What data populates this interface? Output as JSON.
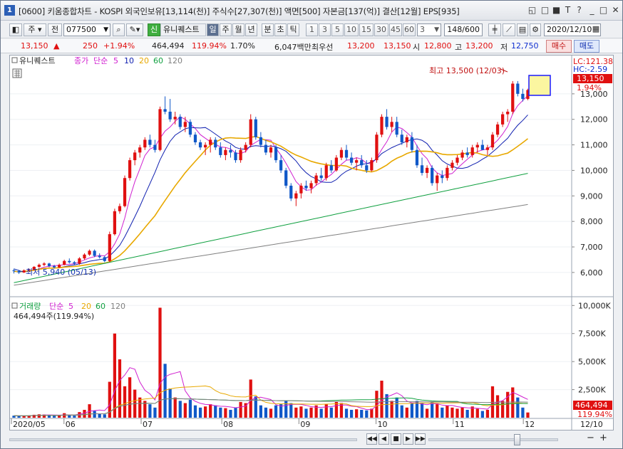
{
  "window": {
    "number": "1",
    "title": "[0600] 키움종합차트 - KOSPI 외국인보유[13,114(천)] 주식수[27,307(천)] 액면[500] 자본금[137(억)] 결산[12월] EPS[935]",
    "controls": [
      "◱",
      "□",
      "■",
      "T",
      "?",
      "_",
      "□",
      "✕"
    ]
  },
  "toolbar": {
    "period_main": "주",
    "mode": "전",
    "code_value": "077500",
    "new_badge": "신",
    "stock_name": "유니퀘스트",
    "periods": [
      "일",
      "주",
      "월",
      "년",
      "분",
      "초",
      "틱"
    ],
    "selected_period": "일",
    "intervals": [
      "1",
      "3",
      "5",
      "10",
      "15",
      "30",
      "45",
      "60"
    ],
    "interval_value": "3",
    "bar_count": "148/600",
    "date": "2020/12/10"
  },
  "quote": {
    "price": "13,150",
    "change_arrow": "▲",
    "change": "250",
    "change_pct": "+1.94%",
    "volume": "464,494",
    "volume_pct": "119.94%",
    "turnover_pct": "1.70%",
    "amount": "6,047백만",
    "best_label": "최우선",
    "ask": "13,200",
    "bid": "13,150",
    "open_label": "시",
    "open": "12,800",
    "high_label": "고",
    "high": "13,200",
    "low_label": "저",
    "low": "12,750",
    "buy_label": "매수",
    "sell_label": "매도"
  },
  "chart_data": [
    {
      "type": "candlestick",
      "title": "유니퀘스트",
      "legend": {
        "price": "종가",
        "ma": "단순",
        "periods": [
          "5",
          "10",
          "20",
          "60",
          "120"
        ],
        "colors": [
          "#d020d0",
          "#1020b0",
          "#e8a800",
          "#10a040",
          "#808080"
        ]
      },
      "y_ticks": [
        "13,000",
        "12,000",
        "11,000",
        "10,000",
        "9,000",
        "8,000",
        "7,000",
        "6,000"
      ],
      "ylim": [
        5300,
        14000
      ],
      "lc_label": "LC:121.38",
      "hc_label": "HC:-2.59",
      "last_price_label": "13,150",
      "last_change_label": "1.94%",
      "annot_high": "최고 13,500 (12/03)",
      "annot_low": "최저 5,940 (05/13)",
      "x_labels": [
        "2020/05",
        "06",
        "07",
        "08",
        "09",
        "10",
        "11",
        "12",
        "12/10"
      ],
      "candles": [
        [
          6080,
          6150,
          5960,
          6050
        ],
        [
          6050,
          6100,
          5940,
          6000
        ],
        [
          6000,
          6120,
          5980,
          6080
        ],
        [
          6080,
          6150,
          6020,
          6100
        ],
        [
          6100,
          6250,
          6080,
          6220
        ],
        [
          6220,
          6350,
          6180,
          6300
        ],
        [
          6300,
          6400,
          6250,
          6350
        ],
        [
          6350,
          6380,
          6200,
          6250
        ],
        [
          6250,
          6300,
          6150,
          6200
        ],
        [
          6200,
          6350,
          6180,
          6300
        ],
        [
          6300,
          6500,
          6280,
          6450
        ],
        [
          6450,
          6550,
          6350,
          6400
        ],
        [
          6400,
          6450,
          6300,
          6350
        ],
        [
          6350,
          6600,
          6300,
          6550
        ],
        [
          6550,
          6750,
          6500,
          6700
        ],
        [
          6700,
          6900,
          6650,
          6850
        ],
        [
          6850,
          6900,
          6600,
          6650
        ],
        [
          6650,
          6750,
          6550,
          6600
        ],
        [
          6600,
          6650,
          6400,
          6450
        ],
        [
          6450,
          7600,
          6400,
          7500
        ],
        [
          7500,
          8500,
          7450,
          8400
        ],
        [
          8400,
          8700,
          8300,
          8600
        ],
        [
          8600,
          9800,
          8550,
          9700
        ],
        [
          9700,
          10500,
          9600,
          10400
        ],
        [
          10400,
          10800,
          10200,
          10700
        ],
        [
          10700,
          11000,
          10500,
          10900
        ],
        [
          10900,
          11300,
          10800,
          11200
        ],
        [
          11200,
          11400,
          10900,
          11000
        ],
        [
          11000,
          11200,
          10700,
          10800
        ],
        [
          10800,
          12500,
          10750,
          12400
        ],
        [
          12400,
          12900,
          12200,
          12300
        ],
        [
          12300,
          12800,
          11900,
          12000
        ],
        [
          12000,
          12300,
          11800,
          12100
        ],
        [
          12100,
          12200,
          11600,
          11700
        ],
        [
          11700,
          12100,
          11500,
          11900
        ],
        [
          11900,
          12000,
          11300,
          11400
        ],
        [
          11400,
          11500,
          11000,
          11100
        ],
        [
          11100,
          11200,
          10800,
          10900
        ],
        [
          10900,
          11100,
          10600,
          11000
        ],
        [
          11000,
          11300,
          10700,
          11200
        ],
        [
          11200,
          11300,
          10800,
          10900
        ],
        [
          10900,
          11100,
          10500,
          10600
        ],
        [
          10600,
          10900,
          10400,
          10800
        ],
        [
          10800,
          11000,
          10500,
          10700
        ],
        [
          10700,
          10800,
          10300,
          10400
        ],
        [
          10400,
          10900,
          10300,
          10800
        ],
        [
          10800,
          11100,
          10700,
          11000
        ],
        [
          11000,
          12200,
          10900,
          12000
        ],
        [
          12000,
          12100,
          11200,
          11300
        ],
        [
          11300,
          11500,
          10900,
          11000
        ],
        [
          11000,
          11200,
          10600,
          10700
        ],
        [
          10700,
          11000,
          10500,
          10900
        ],
        [
          10900,
          11000,
          10300,
          10400
        ],
        [
          10400,
          10600,
          9900,
          10000
        ],
        [
          10000,
          10100,
          9300,
          9400
        ],
        [
          9400,
          9500,
          8800,
          8900
        ],
        [
          8900,
          9200,
          8600,
          9100
        ],
        [
          9100,
          9500,
          8900,
          9400
        ],
        [
          9400,
          9600,
          9200,
          9300
        ],
        [
          9300,
          9600,
          9100,
          9500
        ],
        [
          9500,
          9900,
          9400,
          9800
        ],
        [
          9800,
          10100,
          9600,
          9700
        ],
        [
          9700,
          10300,
          9600,
          10200
        ],
        [
          10200,
          10400,
          9900,
          10000
        ],
        [
          10000,
          10600,
          9950,
          10500
        ],
        [
          10500,
          10900,
          10400,
          10800
        ],
        [
          10800,
          11000,
          10400,
          10500
        ],
        [
          10500,
          10700,
          10200,
          10300
        ],
        [
          10300,
          10500,
          10000,
          10400
        ],
        [
          10400,
          10600,
          10100,
          10200
        ],
        [
          10200,
          10400,
          9900,
          10000
        ],
        [
          10000,
          10500,
          9950,
          10400
        ],
        [
          10400,
          11500,
          10300,
          11400
        ],
        [
          11400,
          12200,
          11300,
          12100
        ],
        [
          12100,
          12400,
          11600,
          11700
        ],
        [
          11700,
          12100,
          11500,
          11900
        ],
        [
          11900,
          12100,
          11300,
          11400
        ],
        [
          11400,
          11600,
          11000,
          11100
        ],
        [
          11100,
          11400,
          10900,
          11300
        ],
        [
          11300,
          11500,
          10700,
          10800
        ],
        [
          10800,
          11000,
          10100,
          10200
        ],
        [
          10200,
          10500,
          9800,
          9900
        ],
        [
          9900,
          10200,
          9700,
          10100
        ],
        [
          10100,
          10200,
          9400,
          9500
        ],
        [
          9500,
          9900,
          9200,
          9800
        ],
        [
          9800,
          10000,
          9500,
          9700
        ],
        [
          9700,
          10200,
          9600,
          10100
        ],
        [
          10100,
          10400,
          10000,
          10300
        ],
        [
          10300,
          10600,
          10200,
          10500
        ],
        [
          10500,
          10800,
          10400,
          10700
        ],
        [
          10700,
          10900,
          10500,
          10600
        ],
        [
          10600,
          11000,
          10500,
          10900
        ],
        [
          10900,
          11100,
          10700,
          11000
        ],
        [
          11000,
          11200,
          10800,
          10800
        ],
        [
          10800,
          11000,
          10600,
          10900
        ],
        [
          10900,
          11500,
          10800,
          11400
        ],
        [
          11400,
          11900,
          11300,
          11800
        ],
        [
          11800,
          12300,
          11700,
          12200
        ],
        [
          12200,
          12400,
          11900,
          12300
        ],
        [
          12300,
          13500,
          12200,
          13400
        ],
        [
          13400,
          13500,
          12900,
          13000
        ],
        [
          13000,
          13200,
          12700,
          12800
        ],
        [
          12800,
          13200,
          12750,
          13150
        ]
      ],
      "ma_series": [
        "MA5",
        "MA10",
        "MA20",
        "MA60",
        "MA120"
      ]
    },
    {
      "type": "bar",
      "title": "거래량",
      "legend": {
        "ma": "단순",
        "periods": [
          "5",
          "20",
          "60",
          "120"
        ],
        "colors": [
          "#d020d0",
          "#e8a800",
          "#10a040",
          "#808080"
        ]
      },
      "volume_label": "464,494주(119.94%)",
      "y_ticks": [
        "10,000K",
        "7,500K",
        "5,000K",
        "2,500K"
      ],
      "ylim": [
        0,
        10400000
      ],
      "last_volume_label": "464,494",
      "last_volume_pct": "119.94%",
      "volumes": [
        180000,
        150000,
        160000,
        200000,
        260000,
        300000,
        280000,
        190000,
        160000,
        220000,
        400000,
        260000,
        180000,
        500000,
        700000,
        1200000,
        600000,
        380000,
        300000,
        3200000,
        7500000,
        5200000,
        2800000,
        3600000,
        2500000,
        1800000,
        1500000,
        1200000,
        900000,
        9800000,
        4800000,
        2600000,
        1800000,
        1500000,
        1300000,
        1600000,
        1100000,
        900000,
        1000000,
        1200000,
        1100000,
        900000,
        850000,
        700000,
        900000,
        1400000,
        1300000,
        3400000,
        1900000,
        1100000,
        900000,
        800000,
        1100000,
        1200000,
        1500000,
        1300000,
        900000,
        1000000,
        800000,
        900000,
        1100000,
        800000,
        1200000,
        900000,
        1400000,
        1300000,
        800000,
        700000,
        750000,
        700000,
        650000,
        800000,
        2400000,
        3300000,
        2100000,
        1500000,
        1800000,
        1100000,
        900000,
        1300000,
        1500000,
        1300000,
        800000,
        1400000,
        1200000,
        900000,
        1100000,
        900000,
        800000,
        900000,
        700000,
        1000000,
        800000,
        600000,
        700000,
        2800000,
        2000000,
        1500000,
        2300000,
        2700000,
        1800000,
        900000,
        464494
      ],
      "volume_colors_up": "#e01010",
      "volume_colors_down": "#1058c8"
    }
  ],
  "bottombar": {
    "nav_buttons": [
      "◀◀",
      "◀",
      "■",
      "▶",
      "▶▶"
    ],
    "zoom_buttons": [
      "−",
      "+"
    ]
  }
}
